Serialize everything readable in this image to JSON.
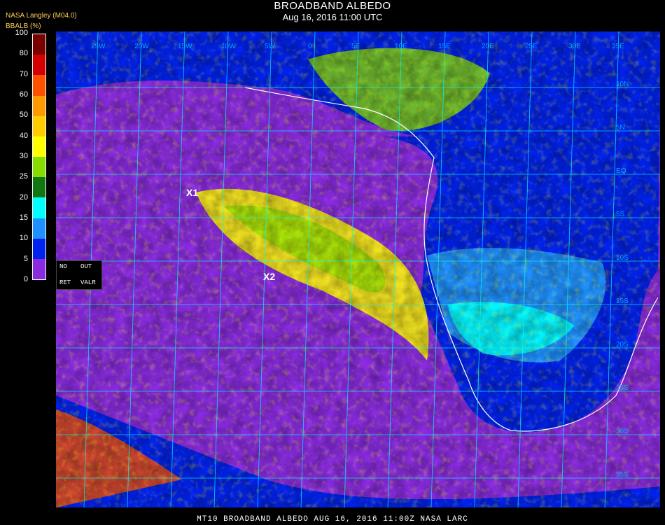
{
  "header": {
    "title": "BROADBAND ALBEDO",
    "datetime": "Aug 16, 2016 11:00 UTC",
    "source": "NASA Langley (M04.0)",
    "unit": "BBALB (%)"
  },
  "colorbar": {
    "ticks": [
      "100",
      "80",
      "70",
      "60",
      "50",
      "40",
      "30",
      "25",
      "20",
      "15",
      "10",
      "5",
      "0"
    ],
    "colors": [
      "#7a0000",
      "#d40000",
      "#ff5000",
      "#ff9900",
      "#ffcc00",
      "#ffff00",
      "#88dd00",
      "#117711",
      "#00ffff",
      "#1e90ff",
      "#0022ee",
      "#8a2be2"
    ]
  },
  "legend": {
    "no": "NO",
    "out": "OUT",
    "ret": "RET",
    "valr": "VALR"
  },
  "markers": {
    "x1": "X1",
    "x2": "X2"
  },
  "lon_labels": [
    "25W",
    "20W",
    "15W",
    "10W",
    "5W",
    "0",
    "5E",
    "10E",
    "15E",
    "20E",
    "25E",
    "30E",
    "35E"
  ],
  "lat_labels": [
    "10N",
    "5N",
    "EQ",
    "5S",
    "10S",
    "15S",
    "20S",
    "25S",
    "30S",
    "35S",
    "40S"
  ],
  "footer": "MT10  BROADBAND ALBEDO   AUG 16, 2016 11:00Z   NASA LARC"
}
